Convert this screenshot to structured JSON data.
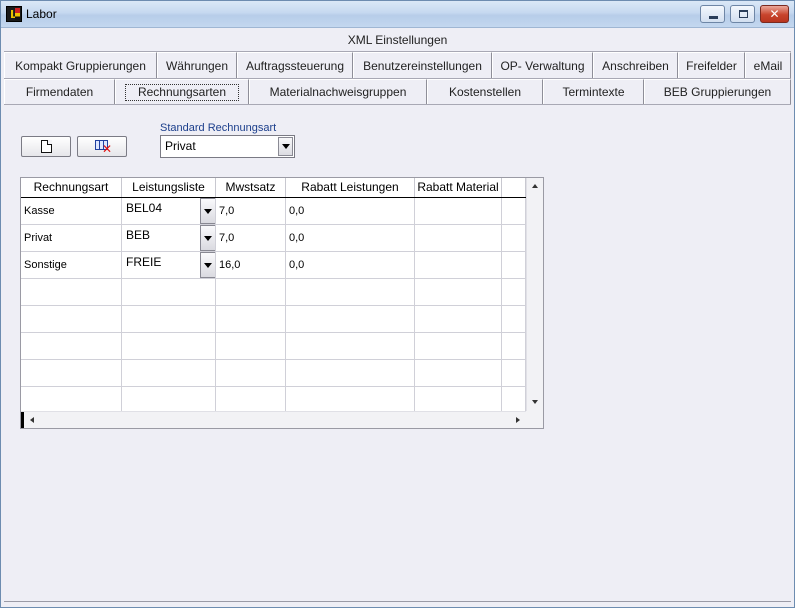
{
  "window": {
    "title": "Labor",
    "app_icon": "app-logo-icon",
    "controls": [
      "minimize-icon",
      "maximize-icon",
      "close-icon"
    ]
  },
  "tabs": {
    "row1": [
      {
        "label": "XML Einstellungen"
      }
    ],
    "row2": [
      {
        "label": "Kompakt Gruppierungen"
      },
      {
        "label": "Währungen"
      },
      {
        "label": "Auftragssteuerung"
      },
      {
        "label": "Benutzereinstellungen"
      },
      {
        "label": "OP- Verwaltung"
      },
      {
        "label": "Anschreiben"
      },
      {
        "label": "Freifelder"
      },
      {
        "label": "eMail"
      }
    ],
    "row3": [
      {
        "label": "Firmendaten"
      },
      {
        "label": "Rechnungsarten",
        "active": true
      },
      {
        "label": "Materialnachweisgruppen"
      },
      {
        "label": "Kostenstellen"
      },
      {
        "label": "Termintexte"
      },
      {
        "label": "BEB Gruppierungen"
      }
    ]
  },
  "toolbar": {
    "new_icon": "new-document-icon",
    "delete_icon": "delete-row-icon"
  },
  "standard": {
    "label": "Standard Rechnungsart",
    "value": "Privat"
  },
  "grid": {
    "columns": [
      "Rechnungsart",
      "Leistungsliste",
      "Mwstsatz",
      "Rabatt Leistungen",
      "Rabatt Material"
    ],
    "rows": [
      {
        "rechnungsart": "Kasse",
        "leistungsliste": "BEL04",
        "mwstsatz": "7,0",
        "rabatt_leistungen": "0,0",
        "rabatt_material": ""
      },
      {
        "rechnungsart": "Privat",
        "leistungsliste": "BEB",
        "mwstsatz": "7,0",
        "rabatt_leistungen": "0,0",
        "rabatt_material": ""
      },
      {
        "rechnungsart": "Sonstige",
        "leistungsliste": "FREIE",
        "mwstsatz": "16,0",
        "rabatt_leistungen": "0,0",
        "rabatt_material": ""
      }
    ],
    "empty_rows": 5
  },
  "colors": {
    "accent": "#1c3f8c",
    "background": "#eeeef5"
  }
}
